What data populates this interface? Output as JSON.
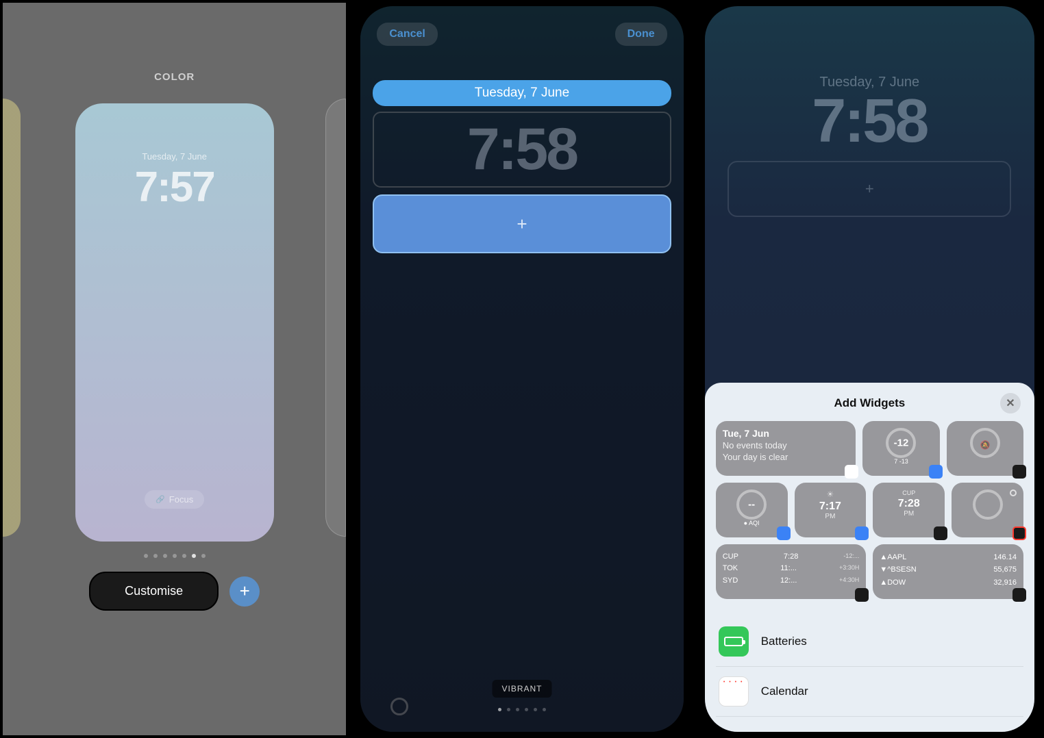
{
  "panel1": {
    "label": "COLOR",
    "date": "Tuesday, 7 June",
    "time": "7:57",
    "focus": "Focus",
    "customise": "Customise"
  },
  "panel2": {
    "cancel": "Cancel",
    "done": "Done",
    "date": "Tuesday, 7 June",
    "time": "7:58",
    "vibrant": "VIBRANT"
  },
  "panel3": {
    "date": "Tuesday, 7 June",
    "time": "7:58",
    "sheet_title": "Add Widgets",
    "widgets": {
      "calendar": {
        "title": "Tue, 7 Jun",
        "line1": "No events today",
        "line2": "Your day is clear"
      },
      "weather_temp": {
        "value": "-12",
        "sub": "7  -13"
      },
      "aqi": {
        "value": "--",
        "label": "● AQI"
      },
      "sunrise": {
        "time": "7:17",
        "ampm": "PM"
      },
      "worldclock_single": {
        "label": "CUP",
        "time": "7:28",
        "ampm": "PM"
      },
      "worldclock_multi": {
        "rows": [
          {
            "city": "CUP",
            "time": "7:28",
            "offset": "-12:..."
          },
          {
            "city": "TOK",
            "time": "11:...",
            "offset": "+3:30H"
          },
          {
            "city": "SYD",
            "time": "12:...",
            "offset": "+4:30H"
          }
        ]
      },
      "stocks": {
        "rows": [
          {
            "sym": "▲AAPL",
            "price": "146.14"
          },
          {
            "sym": "▼^BSESN",
            "price": "55,675"
          },
          {
            "sym": "▲DOW",
            "price": "32,916"
          }
        ]
      }
    },
    "apps": {
      "batteries": "Batteries",
      "calendar": "Calendar"
    }
  }
}
